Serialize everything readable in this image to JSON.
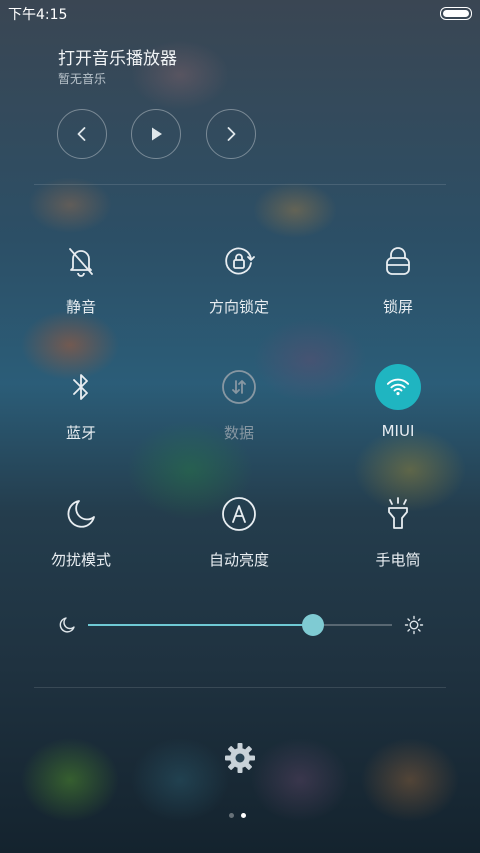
{
  "status": {
    "time": "下午4:15"
  },
  "music": {
    "title": "打开音乐播放器",
    "subtitle": "暂无音乐"
  },
  "toggles": [
    {
      "label": "静音",
      "icon": "bell-off-icon"
    },
    {
      "label": "方向锁定",
      "icon": "rotation-lock-icon"
    },
    {
      "label": "锁屏",
      "icon": "lock-icon"
    },
    {
      "label": "蓝牙",
      "icon": "bluetooth-icon"
    },
    {
      "label": "数据",
      "icon": "mobile-data-icon",
      "state": "disabled"
    },
    {
      "label": "MIUI",
      "icon": "wifi-icon",
      "state": "on"
    },
    {
      "label": "勿扰模式",
      "icon": "moon-icon"
    },
    {
      "label": "自动亮度",
      "icon": "auto-brightness-icon"
    },
    {
      "label": "手电筒",
      "icon": "flashlight-icon"
    }
  ],
  "brightness": {
    "level": 0.74
  },
  "pager": {
    "count": 2,
    "current": 1
  },
  "colors": {
    "accent": "#1fb5c1",
    "slider": "#6fc9d4"
  }
}
